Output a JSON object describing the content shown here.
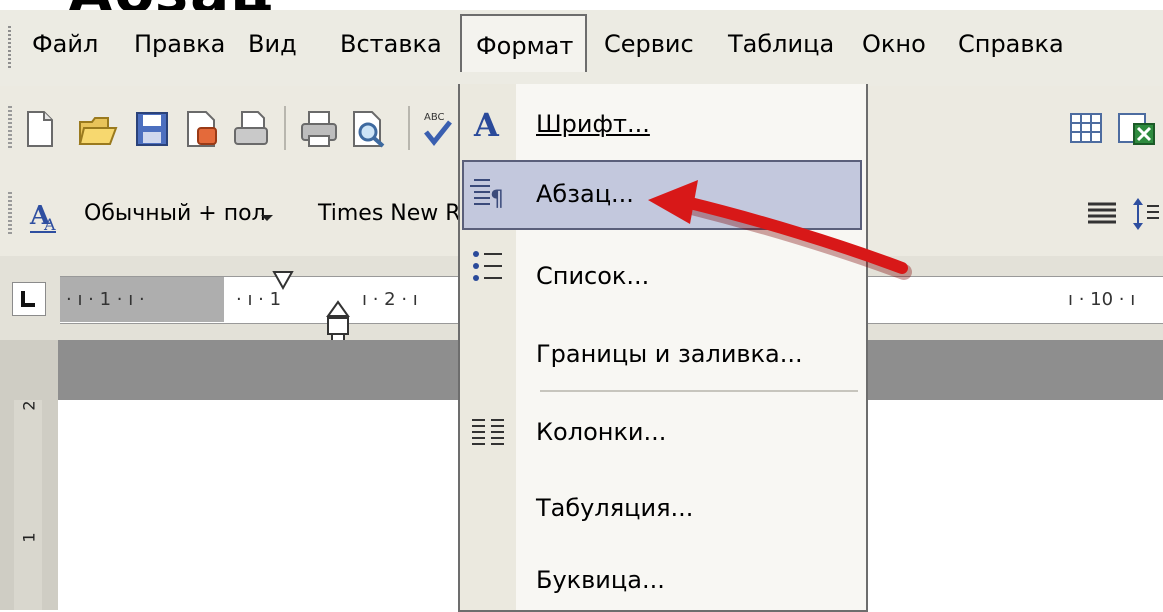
{
  "cropped_title": "Абзац",
  "menu": {
    "file": "Файл",
    "edit": "Правка",
    "view": "Вид",
    "insert": "Вставка",
    "format": "Формат",
    "service": "Сервис",
    "table": "Таблица",
    "window": "Окно",
    "help": "Справка"
  },
  "formatting": {
    "style_value": "Обычный + пол",
    "font_value": "Times New R"
  },
  "ruler": {
    "left_marks": "· ı · 1 · ı ·",
    "mid_marks": "· ı · 1",
    "after_marks": "ı · 2 · ı",
    "right_marks": "ı · 10 · ı"
  },
  "vertical_ruler": {
    "mark2": "2",
    "mark1": "1"
  },
  "format_menu": {
    "items": [
      {
        "label": "Шрифт...",
        "icon": "font-icon"
      },
      {
        "label": "Абзац...",
        "icon": "paragraph-icon",
        "highlighted": true
      },
      {
        "label": "Список...",
        "icon": "list-icon"
      },
      {
        "label": "Границы и заливка...",
        "icon": ""
      },
      {
        "label": "Колонки...",
        "icon": "columns-icon"
      },
      {
        "label": "Табуляция...",
        "icon": ""
      },
      {
        "label": "Буквица...",
        "icon": ""
      }
    ]
  },
  "colors": {
    "highlight": "#c3c8dd",
    "arrow": "#d81818",
    "toolbar": "#eceae1"
  }
}
